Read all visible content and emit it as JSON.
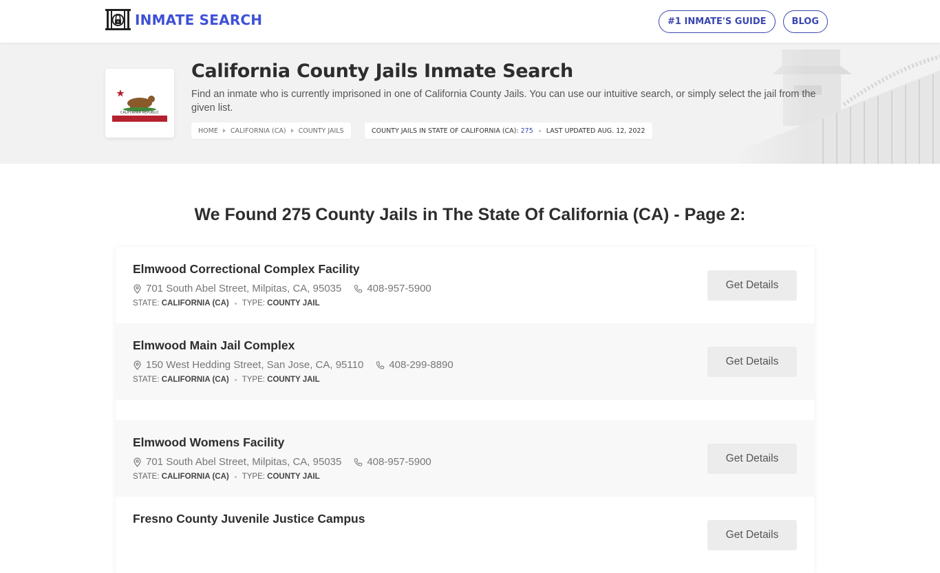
{
  "header": {
    "logo_text": "INMATE SEARCH",
    "nav": [
      {
        "label": "#1 INMATE'S GUIDE"
      },
      {
        "label": "BLOG"
      }
    ],
    "accent_color": "#3f51d6"
  },
  "hero": {
    "title": "California County Jails Inmate Search",
    "description": "Find an inmate who is currently imprisoned in one of California County Jails. You can use our intuitive search, or simply select the jail from the given list.",
    "flag_text": "CALIFORNIA REPUBLIC",
    "breadcrumb": [
      {
        "label": "HOME"
      },
      {
        "label": "CALIFORNIA (CA)"
      },
      {
        "label": "COUNTY JAILS"
      }
    ],
    "stats": {
      "count_label": "COUNTY JAILS IN STATE OF CALIFORNIA (CA):",
      "count_value": "275",
      "updated_label": "LAST UPDATED AUG. 12, 2022"
    }
  },
  "main": {
    "heading": "We Found 275 County Jails in The State Of California (CA) - Page 2:",
    "state_label": "STATE:",
    "type_label": "TYPE:",
    "details_label": "Get Details",
    "items": [
      {
        "name": "Elmwood Correctional Complex Facility",
        "address": "701 South Abel Street, Milpitas, CA, 95035",
        "phone": "408-957-5900",
        "state": "CALIFORNIA (CA)",
        "type": "COUNTY JAIL"
      },
      {
        "name": "Elmwood Main Jail Complex",
        "address": "150 West Hedding Street, San Jose, CA, 95110",
        "phone": "408-299-8890",
        "state": "CALIFORNIA (CA)",
        "type": "COUNTY JAIL"
      },
      {
        "name": "Elmwood Womens Facility",
        "address": "701 South Abel Street, Milpitas, CA, 95035",
        "phone": "408-957-5900",
        "state": "CALIFORNIA (CA)",
        "type": "COUNTY JAIL"
      },
      {
        "name": "Fresno County Juvenile Justice Campus",
        "address": "",
        "phone": "",
        "state": "",
        "type": ""
      }
    ]
  }
}
